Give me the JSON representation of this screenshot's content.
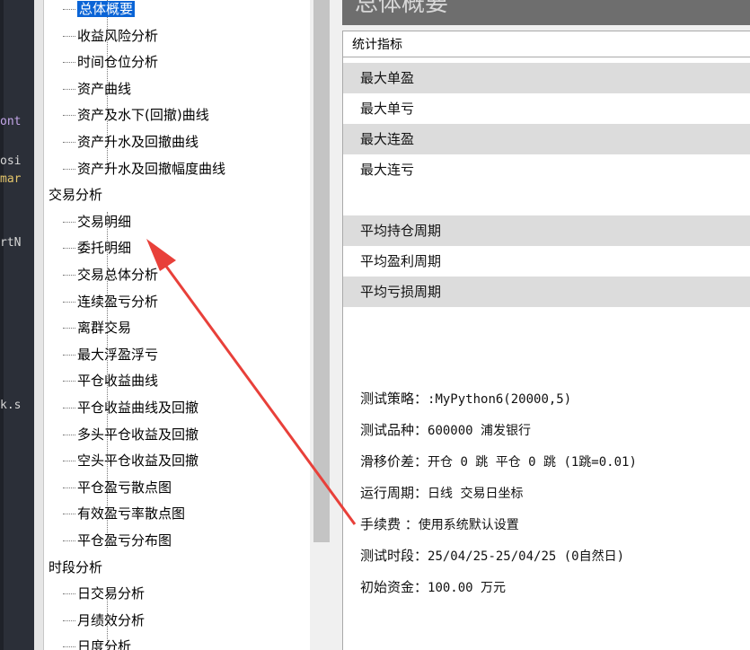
{
  "code_fragments": [
    {
      "text": "ont",
      "color": "#c3a6e8"
    },
    {
      "text": "osi",
      "color": "#d7d7d7"
    },
    {
      "text": "mar",
      "color": "#e3c56b"
    },
    {
      "text": "rtN",
      "color": "#d7d7d7"
    },
    {
      "text": "k.s",
      "color": "#d7d7d7"
    }
  ],
  "tree": {
    "items": [
      {
        "label": "总体概要",
        "type": "child",
        "selected": true
      },
      {
        "label": "收益风险分析",
        "type": "child"
      },
      {
        "label": "时间仓位分析",
        "type": "child"
      },
      {
        "label": "资产曲线",
        "type": "child"
      },
      {
        "label": "资产及水下(回撤)曲线",
        "type": "child"
      },
      {
        "label": "资产升水及回撤曲线",
        "type": "child"
      },
      {
        "label": "资产升水及回撤幅度曲线",
        "type": "child"
      },
      {
        "label": "交易分析",
        "type": "group"
      },
      {
        "label": "交易明细",
        "type": "child"
      },
      {
        "label": "委托明细",
        "type": "child"
      },
      {
        "label": "交易总体分析",
        "type": "child"
      },
      {
        "label": "连续盈亏分析",
        "type": "child"
      },
      {
        "label": "离群交易",
        "type": "child"
      },
      {
        "label": "最大浮盈浮亏",
        "type": "child"
      },
      {
        "label": "平仓收益曲线",
        "type": "child"
      },
      {
        "label": "平仓收益曲线及回撤",
        "type": "child"
      },
      {
        "label": "多头平仓收益及回撤",
        "type": "child"
      },
      {
        "label": "空头平仓收益及回撤",
        "type": "child"
      },
      {
        "label": "平仓盈亏散点图",
        "type": "child"
      },
      {
        "label": "有效盈亏率散点图",
        "type": "child"
      },
      {
        "label": "平仓盈亏分布图",
        "type": "child"
      },
      {
        "label": "时段分析",
        "type": "group"
      },
      {
        "label": "日交易分析",
        "type": "child"
      },
      {
        "label": "月绩效分析",
        "type": "child"
      },
      {
        "label": "日度分析",
        "type": "child"
      }
    ]
  },
  "banner": {
    "title": "总体概要"
  },
  "grid": {
    "header": "统计指标",
    "rows": [
      {
        "label": "最大单盈",
        "alt": true
      },
      {
        "label": "最大单亏",
        "alt": false
      },
      {
        "label": "最大连盈",
        "alt": true
      },
      {
        "label": "最大连亏",
        "alt": false
      },
      {
        "label": "",
        "alt": false
      },
      {
        "label": "平均持仓周期",
        "alt": true
      },
      {
        "label": "平均盈利周期",
        "alt": false
      },
      {
        "label": "平均亏损周期",
        "alt": true
      }
    ]
  },
  "info": [
    {
      "label": "测试策略：",
      "value": ":MyPython6(20000,5)"
    },
    {
      "label": "测试品种：",
      "value": "600000 浦发银行"
    },
    {
      "label": "滑移价差：",
      "value": "开仓 0 跳 平仓 0 跳 (1跳=0.01)"
    },
    {
      "label": "运行周期：",
      "value": "日线 交易日坐标"
    },
    {
      "label": "手续费  ：",
      "value": "使用系统默认设置"
    },
    {
      "label": "测试时段：",
      "value": "25/04/25-25/04/25 (0自然日)"
    },
    {
      "label": "初始资金：",
      "value": "100.00 万元"
    }
  ],
  "annotation": {
    "type": "red-arrow",
    "color": "#e8403a"
  }
}
